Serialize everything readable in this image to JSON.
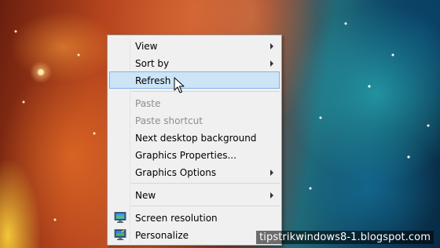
{
  "context_menu": {
    "items": [
      {
        "label": "View",
        "submenu": true
      },
      {
        "label": "Sort by",
        "submenu": true
      },
      {
        "label": "Refresh",
        "state": "hover"
      },
      {
        "label": "Paste",
        "state": "disabled"
      },
      {
        "label": "Paste shortcut",
        "state": "disabled"
      },
      {
        "label": "Next desktop background"
      },
      {
        "label": "Graphics Properties..."
      },
      {
        "label": "Graphics Options",
        "submenu": true
      },
      {
        "label": "New",
        "submenu": true
      },
      {
        "label": "Screen resolution",
        "icon": "screen-resolution-icon"
      },
      {
        "label": "Personalize",
        "icon": "personalize-icon"
      }
    ]
  },
  "watermark": {
    "text": "tipstrikwindows8-1.blogspot.com"
  },
  "colors": {
    "hover_bg": "#cde4f7",
    "hover_border": "#7eb4ea",
    "menu_bg": "#f0f0f0",
    "disabled_text": "#8d8d8d"
  }
}
